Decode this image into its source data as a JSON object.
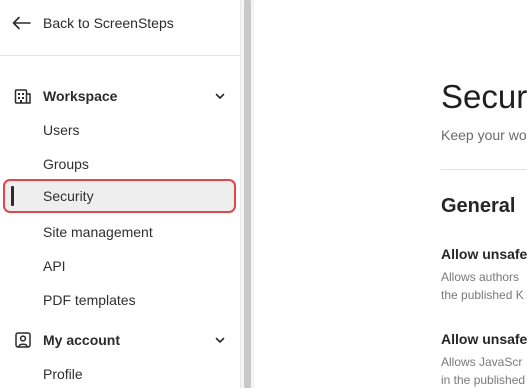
{
  "sidebar": {
    "back_label": "Back to ScreenSteps",
    "sections": [
      {
        "label": "Workspace",
        "items": [
          "Users",
          "Groups",
          "Security",
          "Site management",
          "API",
          "PDF templates"
        ]
      },
      {
        "label": "My account",
        "items": [
          "Profile"
        ]
      }
    ],
    "active_item": "Security"
  },
  "main": {
    "title": "Securit",
    "subtitle": "Keep your wo",
    "section_title": "General",
    "settings": [
      {
        "title": "Allow unsafe",
        "desc_line1": "Allows authors",
        "desc_line2": "the published K"
      },
      {
        "title": "Allow unsafe",
        "desc_line1": "Allows JavaScr",
        "desc_line2": "in the published"
      }
    ]
  },
  "colors": {
    "highlight_border": "#e0474c",
    "active_bg": "#eeeeee",
    "text": "#2b2b2b",
    "muted": "#7a7a7a"
  },
  "icons": {
    "back": "arrow-left-icon",
    "workspace": "building-icon",
    "account": "user-square-icon",
    "chevron": "chevron-down-icon"
  }
}
